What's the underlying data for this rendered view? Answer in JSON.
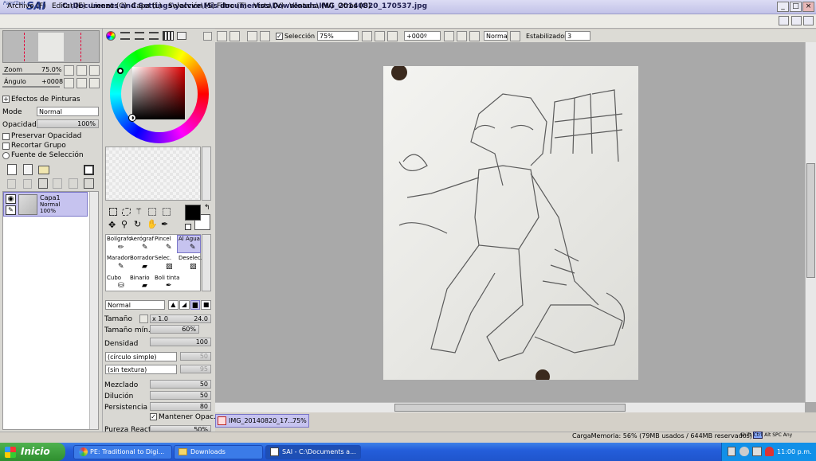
{
  "app": {
    "logo_small": "PaintTool",
    "logo_big": "SAI",
    "title": "C:\\Documents and Settings\\yalvve\\Mis documentos\\Downloads\\IMG_20140820_170537.jpg"
  },
  "menu": [
    "Archivo (F)",
    "Editar (E)",
    "Lienzo (C)",
    "Capa (L)",
    "Selección (S)",
    "Filtro (T)",
    "Vista (V)",
    "Ventana (W)",
    "Otros (O)"
  ],
  "window_buttons": {
    "minimize": "_",
    "maximize": "□",
    "close": "×"
  },
  "toolbar": {
    "selection_label": "Selección",
    "selection_checked": true,
    "zoom": "75%",
    "angle": "+000º",
    "blend": "Normal",
    "stabilizer_label": "Estabilizador",
    "stabilizer": "3"
  },
  "navigator": {
    "zoom_label": "Zoom",
    "zoom_value": "75.0%",
    "angle_label": "Ángulo",
    "angle_value": "+0008"
  },
  "layer_panel": {
    "effects_label": "Efectos de Pinturas",
    "mode_label": "Mode",
    "mode_value": "Normal",
    "opacity_label": "Opacidad",
    "opacity_value": "100%",
    "preserve_opacity": "Preservar Opacidad",
    "clip_group": "Recortar Grupo",
    "selection_source": "Fuente de Selección",
    "layer": {
      "name": "Capa1",
      "mode": "Normal",
      "opacity": "100%"
    }
  },
  "tools": [
    [
      "Bolígrafo",
      "Aerógraf",
      "Pincel",
      "Al Agua"
    ],
    [
      "Marador",
      "Borrador",
      "Selec.",
      "Deselec."
    ],
    [
      "Cubo",
      "Binario",
      "Boli tinta",
      ""
    ]
  ],
  "brush": {
    "blend": "Normal",
    "size_label": "Tamaño",
    "size_mult": "x 1.0",
    "size_value": "24.0",
    "min_size_label": "Tamaño mín.",
    "min_size_value": "60%",
    "density_label": "Densidad",
    "density_value": "100",
    "shape": "(círculo simple)",
    "shape_value": "50",
    "texture": "(sin textura)",
    "texture_value": "95",
    "blending_label": "Mezclado",
    "blending_value": "50",
    "dilution_label": "Dilución",
    "dilution_value": "50",
    "persistence_label": "Persistencia",
    "persistence_value": "80",
    "keep_opacity_label": "Mantener Opac.",
    "cut_label": "Pureza Reactal",
    "cut_value": "50%"
  },
  "doc_tab": {
    "name": "IMG_20140820_17...",
    "zoom": "75%"
  },
  "status": {
    "memory": "CargaMemoria: 56% (79MB usados / 644MB reservados)",
    "keys": [
      "Shift",
      "Ctrl",
      "Alt",
      "SPC",
      "Any"
    ]
  },
  "taskbar": {
    "start": "Inicio",
    "tasks": [
      "PE: Traditional to Digi...",
      "Downloads",
      "SAI - C:\\Documents a..."
    ],
    "clock": "11:00 p.m."
  },
  "colors": {
    "accent": "#2a3f8f",
    "title_bg": "#c8c8ec",
    "foreground_color": "#000000",
    "background_color": "#ffffff"
  }
}
